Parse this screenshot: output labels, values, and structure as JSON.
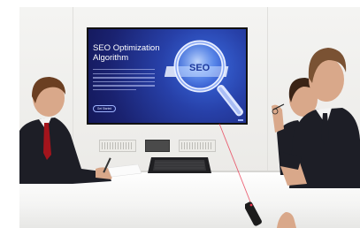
{
  "scene": {
    "description_role": "photo of a business meeting: three men viewing a presentation on a wall-mounted screen"
  },
  "screen": {
    "title": "SEO Optimization Algorithm",
    "button_label": "Get Started",
    "magnifier_label": "SEO"
  },
  "colors": {
    "screen_accent": "#2740a8",
    "screen_dark": "#14185a",
    "laser": "#e8304a",
    "suit": "#1d1e26",
    "tie": "#a3141c"
  }
}
